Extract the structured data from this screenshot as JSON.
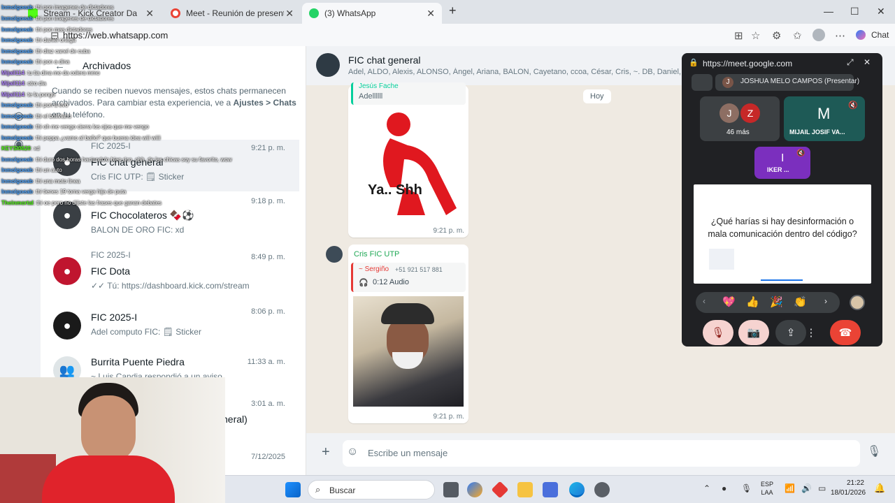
{
  "browser": {
    "tabs": [
      {
        "label": "Stream - Kick Creator Da"
      },
      {
        "label": "Meet - Reunión de presentaci"
      },
      {
        "label": "(3) WhatsApp"
      }
    ],
    "new_tab": "+",
    "url": "https://web.whatsapp.com",
    "chat_button": "Chat",
    "win_min": "—",
    "win_max": "☐",
    "win_close": "✕"
  },
  "left": {
    "title": "Archivados",
    "info_text": "Cuando se reciben nuevos mensajes, estos chats permanecen archivados. Para cambiar esta experiencia, ve a",
    "info_bold": "Ajustes > Chats",
    "info_tail": "en tu teléfono.",
    "chats": [
      {
        "group": "FIC 2025-I",
        "name": "FIC chat general",
        "preview": "Cris FIC UTP: 🗒 Sticker",
        "time": "9:21 p. m."
      },
      {
        "group": "",
        "name": "FIC Chocolateros 🍫⚽",
        "preview": "BALON DE ORO FIC: xd",
        "time": "9:18 p. m."
      },
      {
        "group": "FIC 2025-I",
        "name": "FIC Dota",
        "preview": "✓✓ Tú: https://dashboard.kick.com/stream",
        "time": "8:49 p. m."
      },
      {
        "group": "",
        "name": "FIC 2025-I",
        "preview": "Adel computo FIC: 🗒 Sticker",
        "time": "8:06 p. m."
      },
      {
        "group": "",
        "name": "Burrita Puente Piedra",
        "preview": "~ Luis Candia respondió a un aviso",
        "time": "11:33 a. m."
      },
      {
        "group": "",
        "name": "neral)",
        "preview": "",
        "time": "3:01 a. m."
      },
      {
        "group": "",
        "name": "",
        "preview": "",
        "time": "7/12/2025"
      }
    ]
  },
  "chat": {
    "title": "FIC chat general",
    "members": "Adel, ALDO, Alexis, ALONSO, Ángel, Ariana, BALON, Cayetano, ccoa, César, Cris, ~. DB, Daniel, Deleg",
    "day": "Hoy",
    "msg1": {
      "sender": "Jesús Fache",
      "text": "Adellllll",
      "sticker_text": "Ya.. Shh",
      "time": "9:21 p. m."
    },
    "msg2": {
      "sender": "Cris FIC UTP",
      "quote_name": "~ Sergiño",
      "quote_phone": "+51 921 517 881",
      "quote_audio": "0:12 Audio",
      "time": "9:21 p. m."
    },
    "composer_placeholder": "Escribe un mensaje"
  },
  "meet": {
    "url": "https://meet.google.com",
    "presenter": "JOSHUA MELO CAMPOS (Presentar)",
    "presenter_initial": "J",
    "tile1_initials": [
      "J",
      "Z"
    ],
    "tile1_more": "46 más",
    "tile2_initial": "M",
    "tile2_name": "MIJAIL JOSIF VA...",
    "tile3_initial": "I",
    "tile3_name": "IKER ...",
    "slide_text": "¿Qué harías si hay desinformación o mala comunicación dentro del código?",
    "reactions": [
      "💖",
      "👍",
      "🎉",
      "👏"
    ]
  },
  "stream_chat": [
    {
      "user": "Inmolgoeab",
      "msg": ": thi pon imagenes de dictadores"
    },
    {
      "user": "Inmolgoeab",
      "msg": ": thi pon imagenes de dictadores"
    },
    {
      "user": "Inmolgoeab",
      "msg": ": thi pon mas dictadores"
    },
    {
      "user": "Inmolgoeab",
      "msg": ": thi daniel ortega"
    },
    {
      "user": "Inmolgoeab",
      "msg": ": thi diaz canel de cuba"
    },
    {
      "user": "Inmolgoeab",
      "msg": ": thi pon a dina"
    },
    {
      "user": "Mijail114",
      "msg": ": tu tia dina me da colera mmo"
    },
    {
      "user": "Mijail114",
      "msg": ": otro dia"
    },
    {
      "user": "Mijail114",
      "msg": ": te la pongo"
    },
    {
      "user": "Inmolgoeab",
      "msg": ": thi pon a evo"
    },
    {
      "user": "Inmolgoeab",
      "msg": ": thi el boliviano"
    },
    {
      "user": "Inmolgoeab",
      "msg": ": thi oh me vengo cierra los ojos que me vengo"
    },
    {
      "user": "Inmolgoeab",
      "msg": ": thi peppa ¿vamo al baño? que buena idea wiii wiiii"
    },
    {
      "user": "KEYSI0620",
      "msg": ": xd"
    },
    {
      "user": "Inmolgoeab",
      "msg": ": thi duro dos horas haciendolo bien rico, ohh, de las chicas soy su favorito, wow"
    },
    {
      "user": "Inmolgoeab",
      "msg": ": thi un auto"
    },
    {
      "user": "Inmolgoeab",
      "msg": ": thi una moto linea"
    },
    {
      "user": "Inmolgoeab",
      "msg": ": thi tienes 19 toma verga hija de puta"
    },
    {
      "user": "Theinmortal",
      "msg": ": thi oe pero no dijiste las frases que ganan debates"
    }
  ],
  "taskbar": {
    "search_placeholder": "Buscar",
    "lang1": "ESP",
    "lang2": "LAA",
    "time": "21:22",
    "date": "18/01/2026"
  },
  "colors": {
    "whatsapp_green": "#25d366",
    "meet_dark": "#202124",
    "hangup_red": "#ea4335",
    "purple_tile": "#7b2fbe"
  }
}
